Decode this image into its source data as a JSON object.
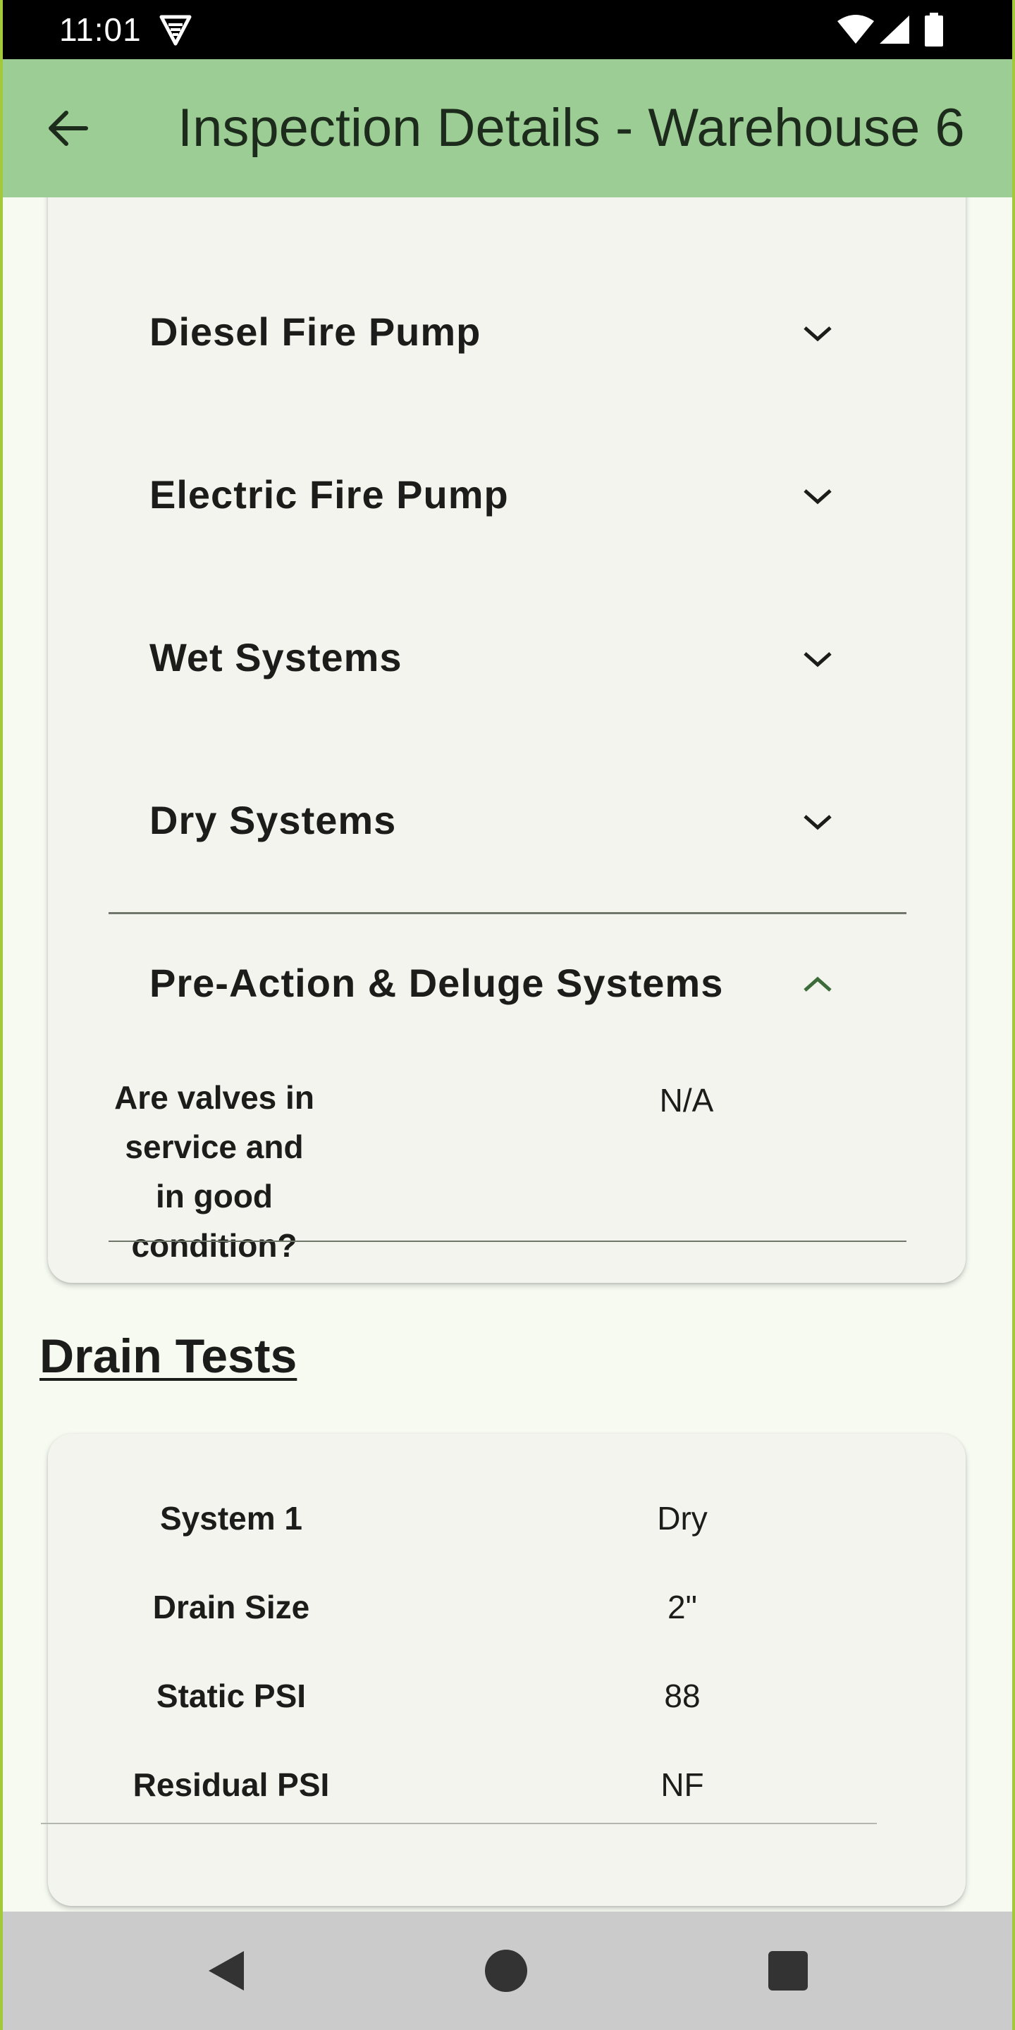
{
  "status_bar": {
    "time": "11:01",
    "icons": [
      "vpn-key-icon",
      "wifi-icon",
      "cell-signal-icon",
      "battery-icon"
    ]
  },
  "app_bar": {
    "back_icon": "arrow-back-icon",
    "title": "Inspection Details - Warehouse 6",
    "background_color": "#9ccd94"
  },
  "systems_card": {
    "sections": [
      {
        "label": "Diesel Fire Pump",
        "expanded": false
      },
      {
        "label": "Electric Fire Pump",
        "expanded": false
      },
      {
        "label": "Wet Systems",
        "expanded": false
      },
      {
        "label": "Dry Systems",
        "expanded": false
      },
      {
        "label": "Pre-Action & Deluge Systems",
        "expanded": true
      }
    ],
    "expanded_items": [
      {
        "question": "Are valves in service and in good condition?",
        "answer": "N/A"
      }
    ],
    "chevron_color": "#1c1c1a",
    "expanded_chevron_color": "#3d6b3a"
  },
  "drain_tests": {
    "heading": "Drain Tests",
    "rows": [
      {
        "label": "System 1",
        "value": "Dry"
      },
      {
        "label": "Drain Size",
        "value": "2\""
      },
      {
        "label": "Static PSI",
        "value": "88"
      },
      {
        "label": "Residual PSI",
        "value": "NF"
      }
    ]
  },
  "nav_bar": {
    "icons": [
      "nav-back-icon",
      "nav-home-icon",
      "nav-recents-icon"
    ]
  }
}
